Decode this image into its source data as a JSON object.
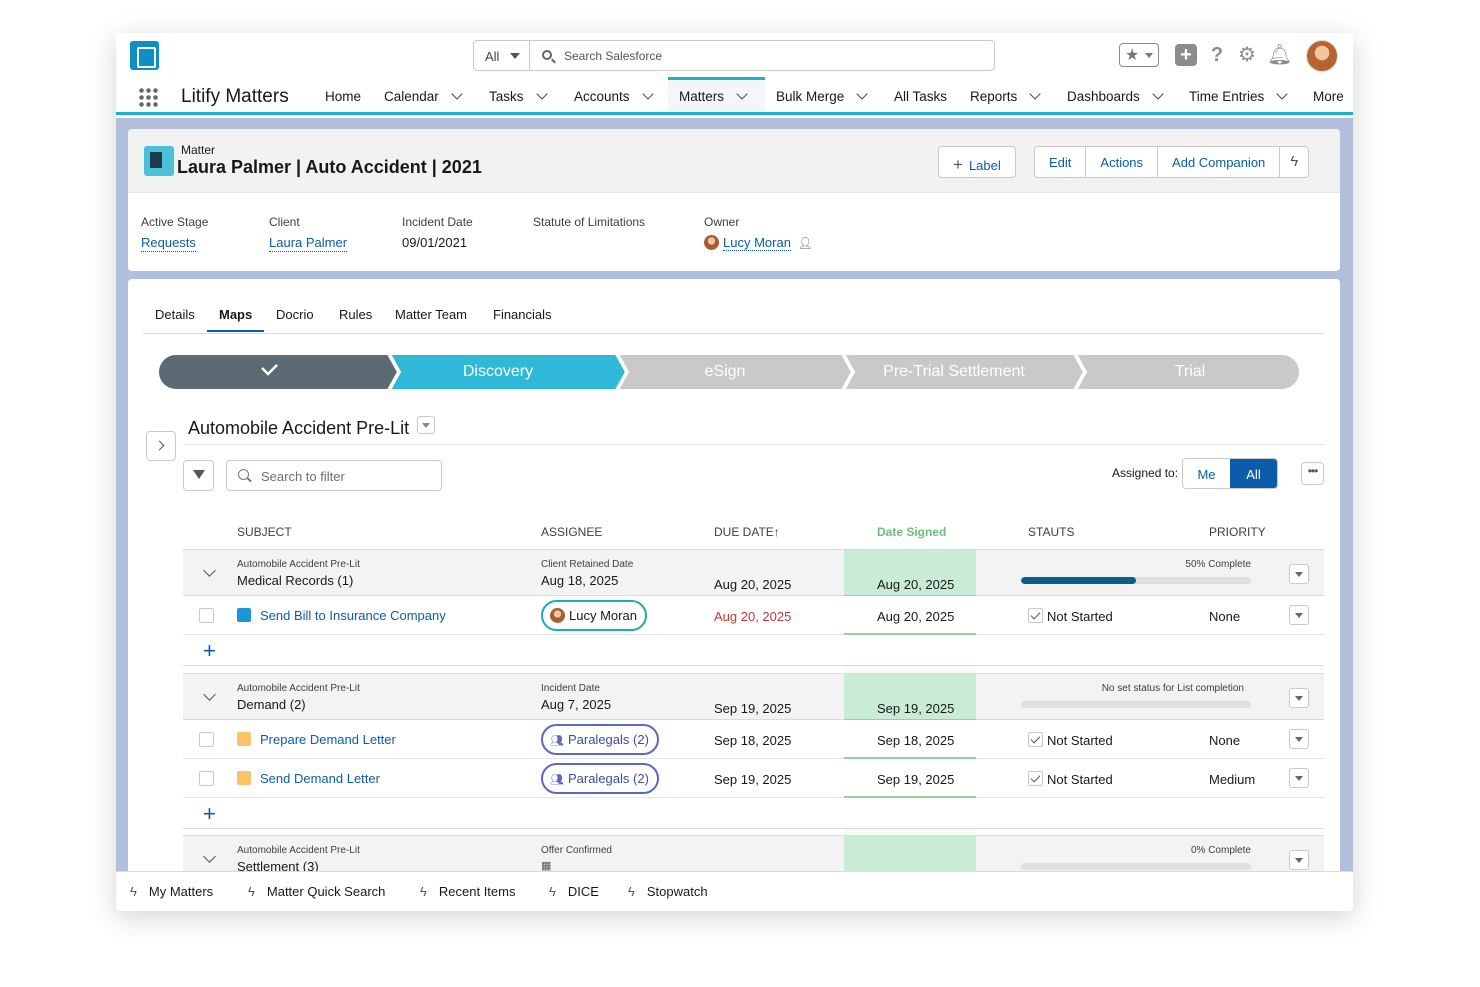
{
  "topbar": {
    "scope": "All",
    "search_placeholder": "Search Salesforce"
  },
  "nav": {
    "app_name": "Litify Matters",
    "items": [
      {
        "label": "Home",
        "has_menu": false
      },
      {
        "label": "Calendar",
        "has_menu": true
      },
      {
        "label": "Tasks",
        "has_menu": true
      },
      {
        "label": "Accounts",
        "has_menu": true
      },
      {
        "label": "Matters",
        "has_menu": true,
        "active": true
      },
      {
        "label": "Bulk Merge",
        "has_menu": true
      },
      {
        "label": "All Tasks",
        "has_menu": false
      },
      {
        "label": "Reports",
        "has_menu": true
      },
      {
        "label": "Dashboards",
        "has_menu": true
      },
      {
        "label": "Time Entries",
        "has_menu": true
      },
      {
        "label": "More",
        "has_menu": false
      }
    ]
  },
  "record": {
    "object_type": "Matter",
    "title": "Laura Palmer | Auto Accident | 2021",
    "actions": {
      "label_btn": "Label",
      "edit": "Edit",
      "actions": "Actions",
      "add_companion": "Add Companion"
    },
    "fields": {
      "active_stage_label": "Active Stage",
      "active_stage": "Requests",
      "client_label": "Client",
      "client": "Laura Palmer",
      "incident_date_label": "Incident Date",
      "incident_date": "09/01/2021",
      "sol_label": "Statute of Limitations",
      "owner_label": "Owner",
      "owner": "Lucy Moran"
    }
  },
  "tabs": [
    "Details",
    "Maps",
    "Docrio",
    "Rules",
    "Matter Team",
    "Financials"
  ],
  "stages": [
    "",
    "Discovery",
    "eSign",
    "Pre-Trial Settlement",
    "Trial"
  ],
  "list": {
    "title": "Automobile Accident Pre-Lit",
    "filter_placeholder": "Search to filter",
    "assigned_to_label": "Assigned to:",
    "assigned_me": "Me",
    "assigned_all": "All",
    "more": "•••"
  },
  "columns": {
    "subject": "SUBJECT",
    "assignee": "ASSIGNEE",
    "due_date": "DUE DATE",
    "due_sort_arrow": "↑",
    "date_signed": "Date Signed",
    "status": "STAUTS",
    "priority": "PRIORITY"
  },
  "groups": [
    {
      "parent": "Automobile Accident Pre-Lit",
      "name": "Medical Records (1)",
      "trigger_label": "Client Retained Date",
      "trigger_date": "Aug 18, 2025",
      "due": "Aug 20, 2025",
      "signed": "Aug 20, 2025",
      "progress_text": "50% Complete",
      "progress": 0.5,
      "tasks": [
        {
          "subject": "Send Bill to Insurance Company",
          "color": "#1b96d6",
          "assignee": "Lucy Moran",
          "assignee_type": "user",
          "due": "Aug 20, 2025",
          "due_overdue": true,
          "signed": "Aug 20, 2025",
          "status": "Not Started",
          "priority": "None"
        }
      ]
    },
    {
      "parent": "Automobile Accident Pre-Lit",
      "name": "Demand (2)",
      "trigger_label": "Incident Date",
      "trigger_date": "Aug 7, 2025",
      "due": "Sep 19, 2025",
      "signed": "Sep 19, 2025",
      "progress_text": "No set status for List completion",
      "progress": 0,
      "tasks": [
        {
          "subject": "Prepare Demand Letter",
          "color": "#fcc366",
          "assignee": "Paralegals (2)",
          "assignee_type": "group",
          "due": "Sep 18, 2025",
          "due_overdue": false,
          "signed": "Sep 18, 2025",
          "status": "Not Started",
          "priority": "None"
        },
        {
          "subject": "Send Demand Letter",
          "color": "#fcc366",
          "assignee": "Paralegals (2)",
          "assignee_type": "group",
          "due": "Sep 19, 2025",
          "due_overdue": false,
          "signed": "Sep 19, 2025",
          "status": "Not Started",
          "priority": "Medium"
        }
      ]
    },
    {
      "parent": "Automobile Accident Pre-Lit",
      "name": "Settlement (3)",
      "trigger_label": "Offer Confirmed",
      "trigger_date": "",
      "due": "",
      "signed": "",
      "progress_text": "0% Complete",
      "progress": 0,
      "tasks": []
    }
  ],
  "utility_bar": [
    "My Matters",
    "Matter Quick Search",
    "Recent Items",
    "DICE",
    "Stopwatch"
  ],
  "colors": {
    "brand": "#0b5cab",
    "accent": "#1ab0d0",
    "stage_complete": "#5b6a73",
    "stage_current": "#2fb8d8",
    "stage_future": "#c9c9c9",
    "overdue": "#c23934"
  }
}
